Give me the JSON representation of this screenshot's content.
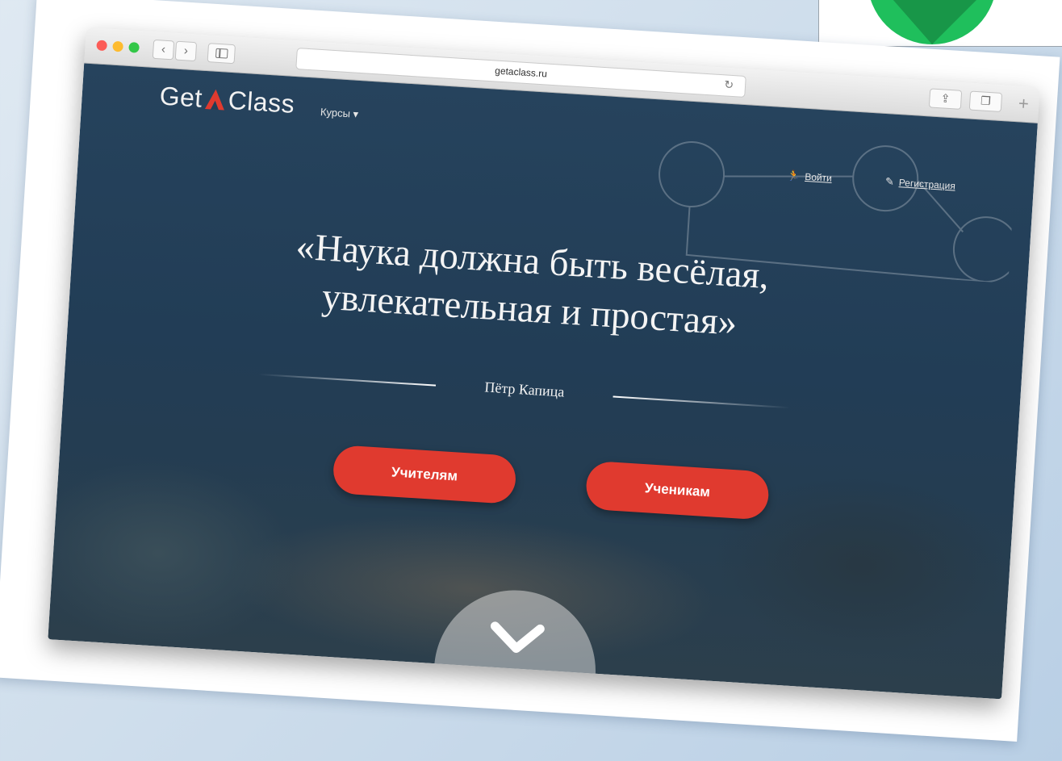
{
  "browser": {
    "url": "getaclass.ru",
    "back_glyph": "‹",
    "forward_glyph": "›",
    "reload_glyph": "↻",
    "share_glyph": "⇪",
    "tabs_glyph": "❐",
    "new_tab_glyph": "+"
  },
  "site": {
    "logo_left": "Get",
    "logo_right": "Class",
    "nav_courses": "Курсы ▾",
    "login_label": "Войти",
    "login_icon": "runner-icon",
    "register_label": "Регистрация",
    "register_icon": "pencil-icon",
    "accent_color": "#e03a2f"
  },
  "hero": {
    "quote_line1": "«Наука должна быть весёлая,",
    "quote_line2": "увлекательная и простая»",
    "author": "Пётр Капица",
    "teachers_button": "Учителям",
    "students_button": "Ученикам",
    "scroll_icon": "chevron-down-icon"
  }
}
